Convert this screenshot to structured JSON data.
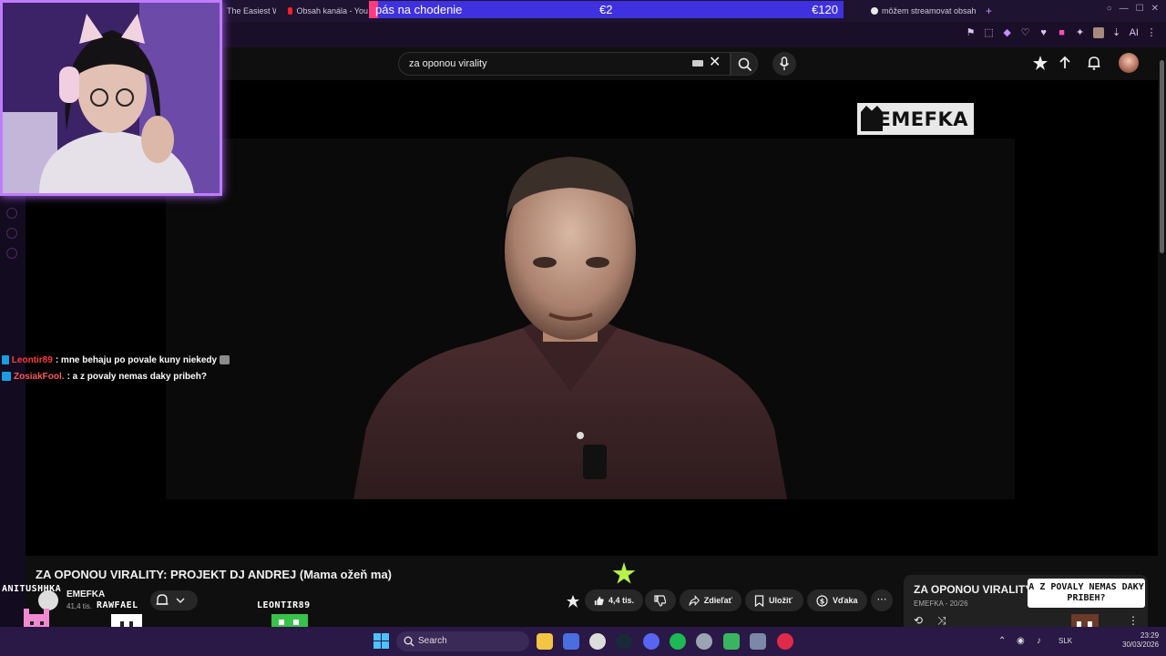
{
  "browser": {
    "tabs": [
      {
        "label": "The Easiest W"
      },
      {
        "label": "Obsah kanála - You"
      },
      {
        "label": "môžem streamovat obsah"
      }
    ],
    "new_tab_symbol": "+",
    "toolbar_ai_label": "AI"
  },
  "donation_goal": {
    "label": "pás na chodenie",
    "current": "€2",
    "target": "€120",
    "progress": 0.017,
    "colors": {
      "bar": "#3f31e0",
      "fill": "#ff3b7f"
    }
  },
  "youtube": {
    "search": {
      "query": "za oponou virality"
    },
    "header_icons": [
      "create-icon",
      "upload-icon",
      "notifications-icon",
      "account-avatar"
    ],
    "video": {
      "watermark": "EMEFKA",
      "title": "ZA OPONOU VIRALITY: PROJEKT DJ ANDREJ (Mama ožeň ma)",
      "channel": "EMEFKA",
      "subscribers": "41,4 tis.",
      "likes": "4,4 tis.",
      "share_label": "Zdieľať",
      "save_label": "Uložiť",
      "thanks_label": "Vďaka",
      "more_symbol": "⋯"
    },
    "playlist": {
      "title": "ZA OPONOU VIRALITY",
      "channel": "EMEFKA",
      "position": "20/26"
    }
  },
  "stream_overlay": {
    "chat": [
      {
        "user": "Leontir89",
        "message": ": mne behaju po povale kuny niekedy"
      },
      {
        "user": "ZosiakFool.",
        "message": ": a z povaly nemas daky pribeh?"
      }
    ],
    "speech_bubble": "A Z POVALY NEMAS DAKY PRIBEH?",
    "pixel_names": [
      "ANITUSHHKA",
      "RAWFAEL",
      "LEONTIR89"
    ]
  },
  "taskbar": {
    "search_placeholder": "Search",
    "language": "SLK",
    "time": "23:29",
    "date": "30/03/2026",
    "app_icons": [
      "file-explorer-icon",
      "store-icon",
      "chrome-icon",
      "steam-icon",
      "discord-icon",
      "spotify-icon",
      "settings-icon",
      "app-icon",
      "app-icon",
      "opera-icon"
    ]
  }
}
